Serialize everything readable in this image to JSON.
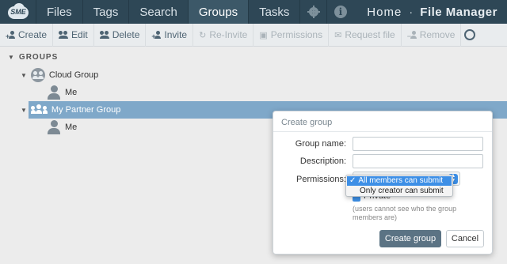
{
  "brand": {
    "logo_text": "SME"
  },
  "nav": {
    "tabs": [
      {
        "label": "Files"
      },
      {
        "label": "Tags"
      },
      {
        "label": "Search"
      },
      {
        "label": "Groups"
      },
      {
        "label": "Tasks"
      }
    ],
    "active_tab": "Groups",
    "home_label": "Home",
    "separator": "·",
    "app_title": "File Manager",
    "icons": [
      "gear-icon",
      "info-icon"
    ]
  },
  "toolbar": {
    "buttons": [
      {
        "label": "Create",
        "icon": "add-user-icon",
        "enabled": true
      },
      {
        "label": "Edit",
        "icon": "users-icon",
        "enabled": true
      },
      {
        "label": "Delete",
        "icon": "users-icon",
        "enabled": true
      },
      {
        "label": "Invite",
        "icon": "add-user-icon",
        "enabled": true
      },
      {
        "label": "Re-Invite",
        "icon": "refresh-icon",
        "enabled": false
      },
      {
        "label": "Permissions",
        "icon": "lock-icon",
        "enabled": false
      },
      {
        "label": "Request file",
        "icon": "envelope-icon",
        "enabled": false
      },
      {
        "label": "Remove",
        "icon": "remove-user-icon",
        "enabled": false
      }
    ]
  },
  "tree": {
    "header": "GROUPS",
    "groups": [
      {
        "name": "Cloud Group",
        "members": [
          "Me"
        ],
        "selected": false
      },
      {
        "name": "My Partner Group",
        "members": [
          "Me"
        ],
        "selected": true
      }
    ]
  },
  "dialog": {
    "title": "Create group",
    "fields": {
      "group_name_label": "Group name:",
      "group_name_value": "",
      "description_label": "Description:",
      "description_value": "",
      "permissions_label": "Permissions:",
      "permissions_value": "All members can submit"
    },
    "private_label": "Private",
    "private_checked": true,
    "hint": "(users cannot see who the group members are)",
    "create_button": "Create group",
    "cancel_button": "Cancel"
  },
  "dropdown": {
    "options": [
      {
        "label": "All members can submit",
        "selected": true
      },
      {
        "label": "Only creator can submit",
        "selected": false
      }
    ],
    "check_mark": "✓"
  },
  "colors": {
    "nav_bg": "#2e4756",
    "nav_active": "#3c5868",
    "selection": "#7fa8c9",
    "primary_button": "#5b7384",
    "accent_blue": "#3d8fe6"
  }
}
